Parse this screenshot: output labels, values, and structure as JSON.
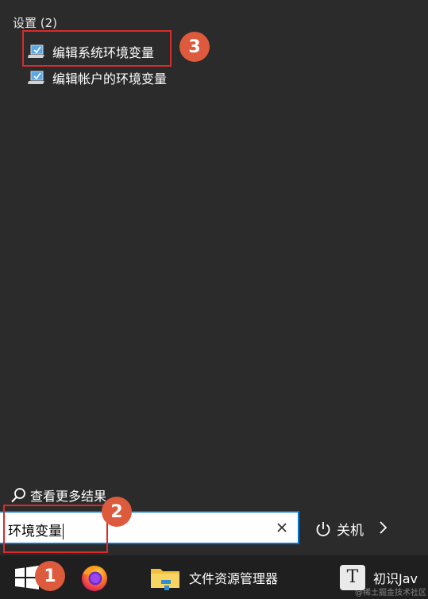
{
  "start_menu": {
    "section_header": "设置 (2)",
    "results": [
      {
        "label": "编辑系统环境变量",
        "icon": "system-settings-icon"
      },
      {
        "label": "编辑帐户的环境变量",
        "icon": "system-settings-icon"
      }
    ],
    "more_results": "查看更多结果"
  },
  "search": {
    "value": "环境变量",
    "clear_icon": "close-icon"
  },
  "power": {
    "label": "关机",
    "icon": "power-icon",
    "chevron_icon": "chevron-right-icon"
  },
  "annotations": {
    "badge_1": "1",
    "badge_2": "2",
    "badge_3": "3",
    "color": "#d92b2b",
    "badge_color": "#dd5a3d"
  },
  "taskbar": {
    "start_icon": "windows-logo-icon",
    "firefox_icon": "firefox-icon",
    "explorer_label": "文件资源管理器",
    "explorer_icon": "folder-icon",
    "typora_label": "初识Jav",
    "typora_icon": "typora-icon",
    "typora_glyph": "T"
  },
  "watermark": "@稀土掘金技术社区"
}
